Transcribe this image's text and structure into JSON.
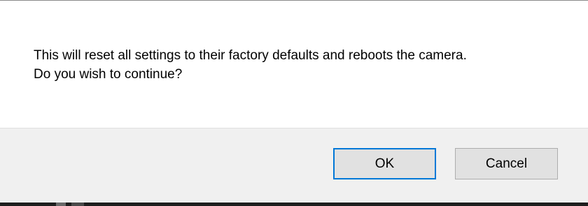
{
  "dialog": {
    "message_line_1": "This will reset all settings to their factory defaults and reboots the camera.",
    "message_line_2": "Do you wish to continue?",
    "ok_label": "OK",
    "cancel_label": "Cancel"
  },
  "colors": {
    "focus_border": "#0078d7",
    "button_face": "#e1e1e1",
    "button_bar": "#f0f0f0"
  }
}
